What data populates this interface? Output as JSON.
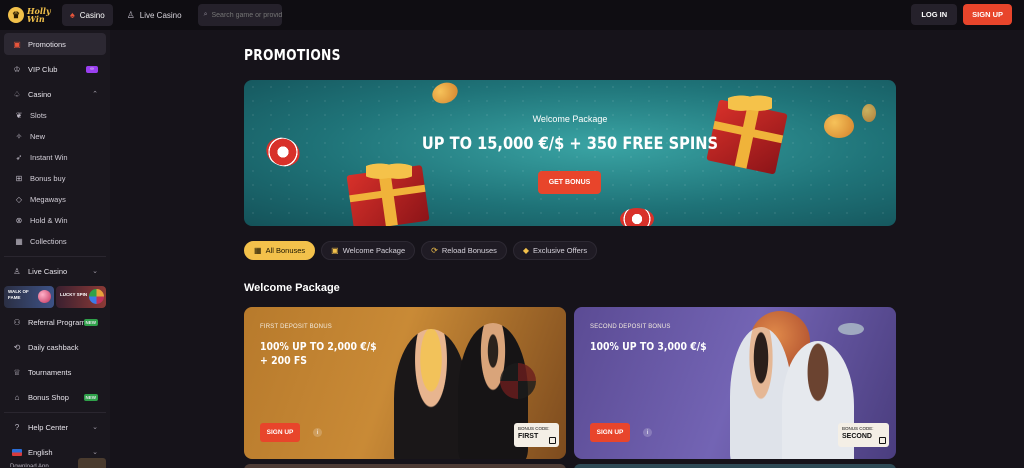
{
  "brand": {
    "line1": "Holly",
    "line2": "Win"
  },
  "topbar": {
    "tabs": [
      {
        "label": "Casino"
      },
      {
        "label": "Live Casino"
      }
    ],
    "search_placeholder": "Search game or provider",
    "login_label": "LOG IN",
    "signup_label": "SIGN UP"
  },
  "sidebar": {
    "items": [
      {
        "label": "Promotions"
      },
      {
        "label": "VIP Club"
      },
      {
        "label": "Casino"
      }
    ],
    "casino_sub": [
      {
        "label": "Slots"
      },
      {
        "label": "New"
      },
      {
        "label": "Instant Win"
      },
      {
        "label": "Bonus buy"
      },
      {
        "label": "Megaways"
      },
      {
        "label": "Hold & Win"
      },
      {
        "label": "Collections"
      }
    ],
    "live_casino": "Live Casino",
    "banners": {
      "walk": "WALK OF FAME",
      "lucky": "LUCKY SPIN"
    },
    "lower": [
      {
        "label": "Referral Program",
        "badge": "NEW"
      },
      {
        "label": "Daily cashback"
      },
      {
        "label": "Tournaments"
      },
      {
        "label": "Bonus Shop",
        "badge": "NEW"
      },
      {
        "label": "Help Center"
      },
      {
        "label": "English"
      }
    ],
    "partial": "Download App"
  },
  "main": {
    "title": "PROMOTIONS",
    "hero": {
      "subtitle": "Welcome Package",
      "title": "UP TO 15,000 €/$ + 350 FREE SPINS",
      "button": "GET BONUS"
    },
    "filters": [
      {
        "label": "All Bonuses",
        "active": true
      },
      {
        "label": "Welcome Package"
      },
      {
        "label": "Reload Bonuses"
      },
      {
        "label": "Exclusive Offers"
      }
    ],
    "section_title": "Welcome Package",
    "cards": [
      {
        "label": "FIRST DEPOSIT BONUS",
        "title": "100% UP TO 2,000 €/$ + 200 FS",
        "button": "SIGN UP",
        "code_label": "BONUS CODE:",
        "code": "FIRST"
      },
      {
        "label": "SECOND DEPOSIT BONUS",
        "title": "100% UP TO 3,000 €/$",
        "button": "SIGN UP",
        "code_label": "BONUS CODE:",
        "code": "SECOND"
      }
    ]
  },
  "colors": {
    "accent": "#e8452b",
    "gold": "#f3c14b",
    "bg": "#16131a",
    "sidebar": "#1a171e"
  }
}
